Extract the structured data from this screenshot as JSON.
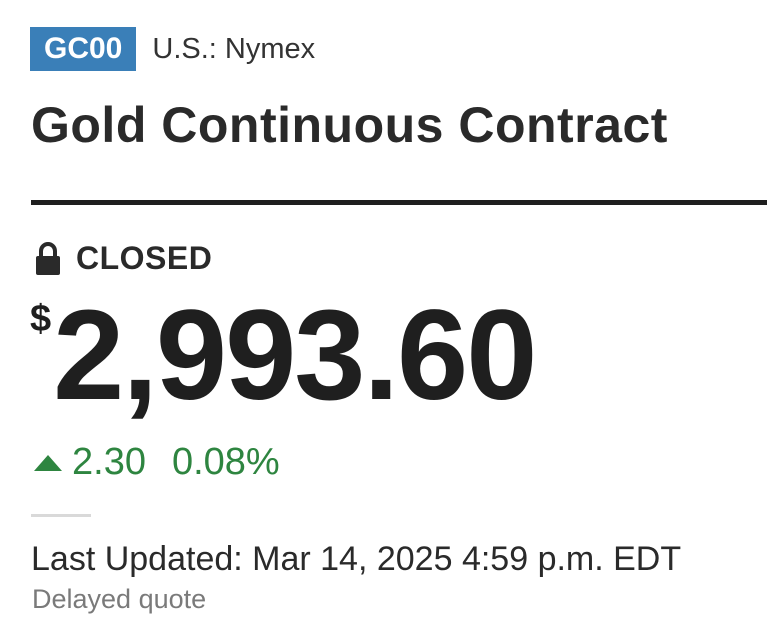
{
  "quote": {
    "ticker": "GC00",
    "exchange": "U.S.: Nymex",
    "title": "Gold Continuous Contract",
    "status": "CLOSED",
    "currency_symbol": "$",
    "price": "2,993.60",
    "change": "2.30",
    "change_percent": "0.08%",
    "last_updated": "Last Updated: Mar 14, 2025 4:59 p.m. EDT",
    "delay_note": "Delayed quote"
  },
  "icons": {
    "status": "lock-icon",
    "direction": "triangle-up-icon"
  },
  "colors": {
    "badge": "#3a7fb8",
    "positive": "#2e8540",
    "text": "#222222",
    "muted": "#7a7a7a"
  }
}
